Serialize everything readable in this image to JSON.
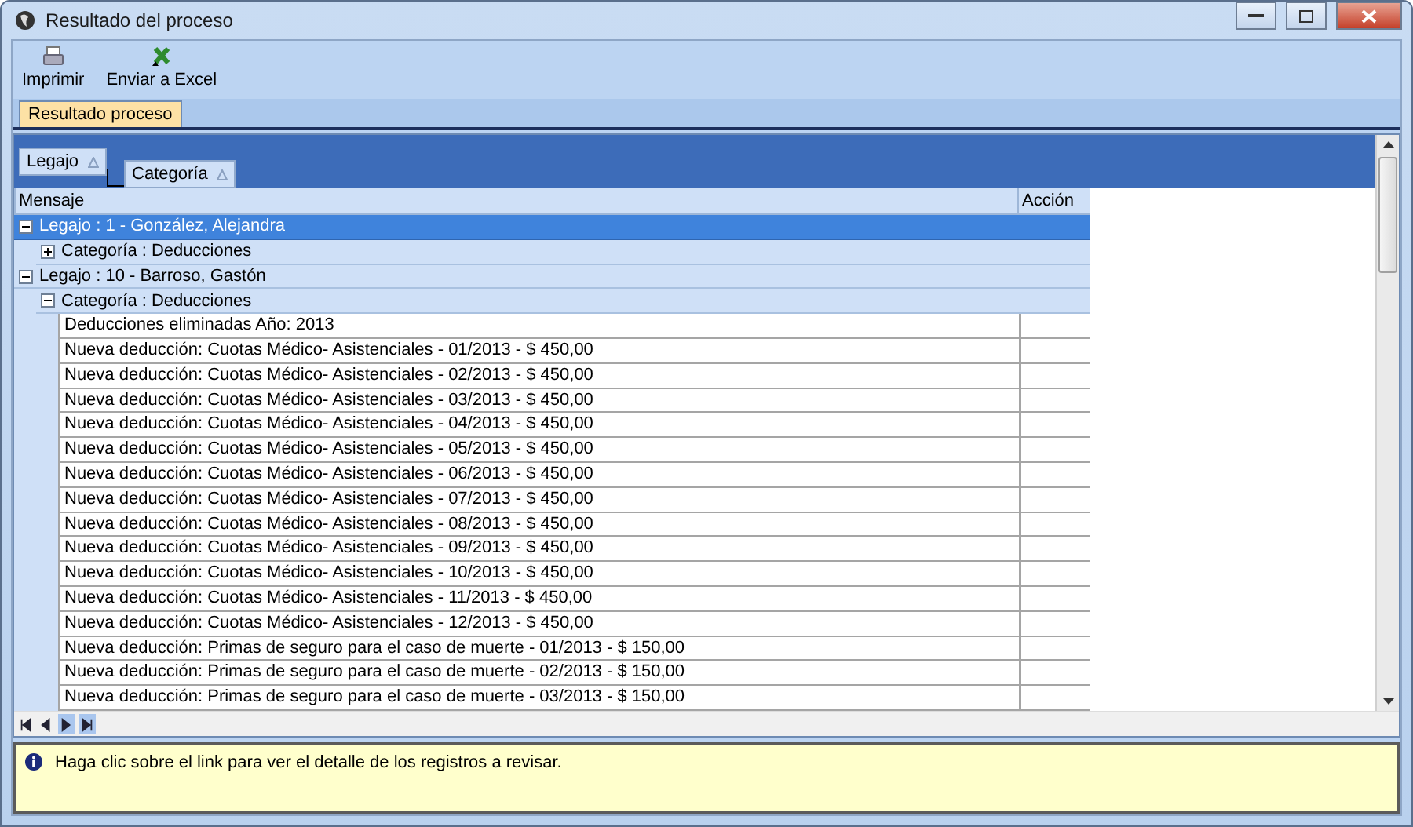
{
  "window": {
    "title": "Resultado del proceso"
  },
  "toolbar": [
    {
      "kind": "print",
      "label": "Imprimir"
    },
    {
      "kind": "excel",
      "label": "Enviar a Excel"
    }
  ],
  "tabs": [
    {
      "label": "Resultado proceso",
      "selected": true
    }
  ],
  "group_by": [
    {
      "label": "Legajo"
    },
    {
      "label": "Categoría"
    }
  ],
  "columns": [
    "Mensaje",
    "Acción"
  ],
  "tree": [
    {
      "kind": "group",
      "label": "Legajo : 1 - González, Alejandra",
      "expanded": true,
      "selected": true,
      "children": [
        {
          "kind": "group",
          "label": "Categoría : Deducciones",
          "expanded": false,
          "selected": false
        }
      ]
    },
    {
      "kind": "group",
      "label": "Legajo : 10 - Barroso, Gastón",
      "expanded": true,
      "selected": false,
      "children": [
        {
          "kind": "group",
          "label": "Categoría : Deducciones",
          "expanded": true,
          "selected": false,
          "children": [
            {
              "text": "Deducciones eliminadas Año: 2013"
            },
            {
              "text": "Nueva deducción: Cuotas Médico- Asistenciales - 01/2013 - $ 450,00"
            },
            {
              "text": "Nueva deducción: Cuotas Médico- Asistenciales - 02/2013 - $ 450,00"
            },
            {
              "text": "Nueva deducción: Cuotas Médico- Asistenciales - 03/2013 - $ 450,00"
            },
            {
              "text": "Nueva deducción: Cuotas Médico- Asistenciales - 04/2013 - $ 450,00"
            },
            {
              "text": "Nueva deducción: Cuotas Médico- Asistenciales - 05/2013 - $ 450,00"
            },
            {
              "text": "Nueva deducción: Cuotas Médico- Asistenciales - 06/2013 - $ 450,00"
            },
            {
              "text": "Nueva deducción: Cuotas Médico- Asistenciales - 07/2013 - $ 450,00"
            },
            {
              "text": "Nueva deducción: Cuotas Médico- Asistenciales - 08/2013 - $ 450,00"
            },
            {
              "text": "Nueva deducción: Cuotas Médico- Asistenciales - 09/2013 - $ 450,00"
            },
            {
              "text": "Nueva deducción: Cuotas Médico- Asistenciales - 10/2013 - $ 450,00"
            },
            {
              "text": "Nueva deducción: Cuotas Médico- Asistenciales - 11/2013 - $ 450,00"
            },
            {
              "text": "Nueva deducción: Cuotas Médico- Asistenciales - 12/2013 - $ 450,00"
            },
            {
              "text": "Nueva deducción: Primas de seguro para el caso de muerte - 01/2013 - $ 150,00"
            },
            {
              "text": "Nueva deducción: Primas de seguro para el caso de muerte - 02/2013 - $ 150,00"
            },
            {
              "text": "Nueva deducción: Primas de seguro para el caso de muerte - 03/2013 - $ 150,00"
            }
          ]
        }
      ]
    }
  ],
  "navigator": [
    {
      "kind": "first",
      "highlighted": false
    },
    {
      "kind": "prev",
      "highlighted": false
    },
    {
      "kind": "next",
      "highlighted": true
    },
    {
      "kind": "last",
      "highlighted": true
    }
  ],
  "message": "Haga clic sobre el link para ver el detalle de los registros a revisar."
}
